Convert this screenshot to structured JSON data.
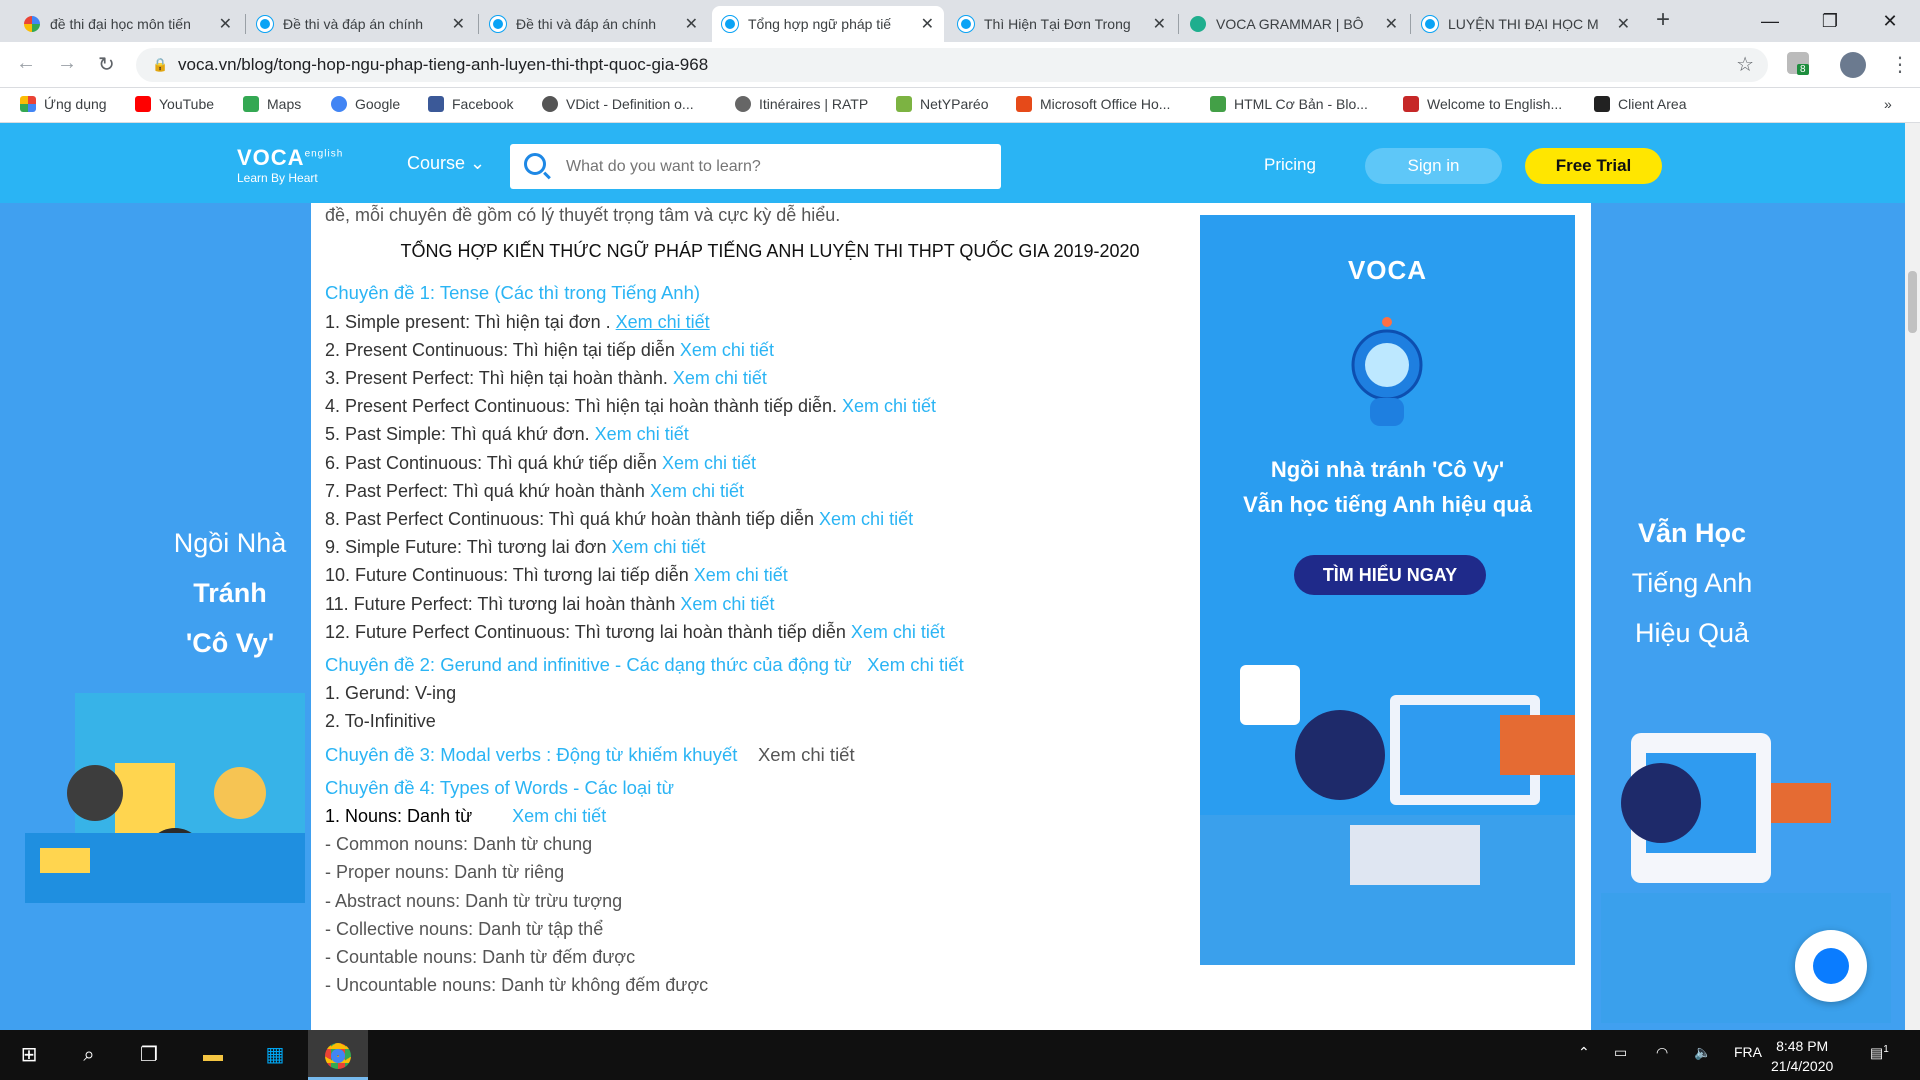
{
  "tabs": [
    {
      "title": "đề thi đại học môn tiến",
      "icon": "google"
    },
    {
      "title": "Đề thi và đáp án chính",
      "icon": "voca"
    },
    {
      "title": "Đề thi và đáp án chính",
      "icon": "voca"
    },
    {
      "title": "Tổng hợp ngữ pháp tiế",
      "icon": "voca",
      "active": true
    },
    {
      "title": "Thì Hiện Tại Đơn Trong",
      "icon": "voca"
    },
    {
      "title": "VOCA GRAMMAR | BÔ",
      "icon": "web"
    },
    {
      "title": "LUYỆN THI ĐẠI HỌC M",
      "icon": "voca"
    }
  ],
  "address": {
    "url": "voca.vn/blog/tong-hop-ngu-phap-tieng-anh-luyen-thi-thpt-quoc-gia-968"
  },
  "extension_badge": "8",
  "bookmarks": [
    {
      "label": "Ứng dụng",
      "color": "#e8453c"
    },
    {
      "label": "YouTube",
      "color": "#ff0000"
    },
    {
      "label": "Maps",
      "color": "#34a853"
    },
    {
      "label": "Google",
      "color": "#4285f4"
    },
    {
      "label": "Facebook",
      "color": "#3b5998"
    },
    {
      "label": "VDict - Definition o...",
      "color": "#555555"
    },
    {
      "label": "Itinéraires | RATP",
      "color": "#666666"
    },
    {
      "label": "NetYParéo",
      "color": "#7cb342"
    },
    {
      "label": "Microsoft Office Ho...",
      "color": "#e64a19"
    },
    {
      "label": "HTML Cơ Bản - Blo...",
      "color": "#43a047"
    },
    {
      "label": "Welcome to English...",
      "color": "#c62828"
    },
    {
      "label": "Client Area",
      "color": "#222222"
    }
  ],
  "site": {
    "logo": "VOCA",
    "logo_sup": "english",
    "tagline": "Learn By Heart",
    "course": "Course",
    "search_placeholder": "What do you want to learn?",
    "pricing": "Pricing",
    "signin": "Sign in",
    "trial": "Free Trial"
  },
  "left_banner": [
    "Ngồi Nhà",
    "Tránh",
    "'Cô Vy'"
  ],
  "right_banner": [
    "Vẫn Học",
    "Tiếng Anh",
    "Hiệu Quả"
  ],
  "article": {
    "intro": "đề, mỗi chuyên đề gồm có lý thuyết trọng tâm và cực kỳ dễ hiểu.",
    "heading": "TỔNG HỢP KIẾN THỨC NGỮ PHÁP TIẾNG ANH LUYỆN THI THPT QUỐC GIA 2019-2020",
    "topic1": "Chuyên đề 1: Tense (Các thì trong Tiếng Anh)",
    "tenses": [
      {
        "text": "1. Simple present: Thì hiện tại đơn . ",
        "link": "Xem chi tiết"
      },
      {
        "text": "2. Present Continuous: Thì hiện tại tiếp diễn ",
        "link": "Xem chi tiết"
      },
      {
        "text": "3. Present Perfect: Thì hiện tại hoàn thành.  ",
        "link": "Xem chi tiết"
      },
      {
        "text": "4. Present Perfect Continuous: Thì hiện tại hoàn thành tiếp diễn. ",
        "link": "Xem chi tiết"
      },
      {
        "text": "5. Past Simple: Thì quá khứ đơn. ",
        "link": "Xem chi tiết"
      },
      {
        "text": "6. Past Continuous: Thì quá khứ tiếp diễn ",
        "link": "Xem chi tiết"
      },
      {
        "text": "7. Past Perfect: Thì quá khứ hoàn thành ",
        "link": "Xem chi tiết"
      },
      {
        "text": "8. Past Perfect Continuous: Thì quá khứ hoàn thành tiếp diễn ",
        "link": "Xem chi tiết"
      },
      {
        "text": "9. Simple Future: Thì tương lai đơn  ",
        "link": "Xem chi tiết"
      },
      {
        "text": "10. Future Continuous: Thì tương lai tiếp diễn   ",
        "link": "Xem chi tiết"
      },
      {
        "text": "11. Future Perfect: Thì tương lai hoàn thành   ",
        "link": "Xem chi tiết"
      },
      {
        "text": "12. Future Perfect Continuous: Thì tương lai hoàn thành tiếp diễn ",
        "link": "Xem chi tiết"
      }
    ],
    "topic2": "Chuyên đề 2: Gerund and infinitive - Các dạng thức của động từ",
    "topic2_link": "Xem chi tiết",
    "gerund": [
      "1. Gerund: V-ing",
      "2. To-Infinitive"
    ],
    "topic3": "Chuyên đề 3: Modal verbs : Động từ khiếm khuyết",
    "topic3_link": "Xem chi tiết",
    "topic4": "Chuyên đề 4: Types of Words - Các loại từ",
    "nouns_title": "1. Nouns: Danh từ",
    "nouns_link": "Xem chi tiết",
    "nouns": [
      "- Common nouns: Danh từ chung",
      "- Proper nouns: Danh từ riêng",
      "- Abstract nouns: Danh từ trừu tượng",
      "- Collective nouns: Danh từ tập thể",
      "- Countable nouns: Danh từ đếm được",
      "- Uncountable nouns: Danh từ không đếm được"
    ]
  },
  "ad": {
    "logo": "VOCA",
    "line1": "Ngồi nhà tránh 'Cô Vy'",
    "line2": "Vẫn học tiếng Anh hiệu quả",
    "cta": "TÌM HIỂU NGAY"
  },
  "taskbar": {
    "lang": "FRA",
    "time": "8:48 PM",
    "date": "21/4/2020",
    "notif_count": "1"
  },
  "colors": {
    "brand": "#2ab4f4",
    "page_bg": "#40a0f0",
    "trial": "#ffe600",
    "link": "#2ab4f4"
  }
}
